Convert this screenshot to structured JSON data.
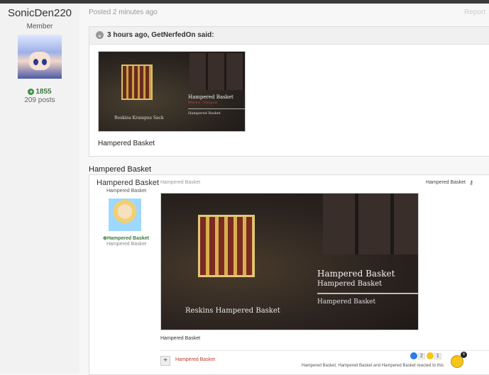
{
  "author": {
    "name": "SonicDen220",
    "role": "Member",
    "reputation": "1855",
    "posts": "209 posts"
  },
  "post": {
    "meta": "Posted 2 minutes ago",
    "report": "Report",
    "quote": {
      "header": "3 hours ago, GetNerfedOn said:",
      "image_text": {
        "item_name": "Hampered Basket",
        "subtitle": "Woven - Elegant",
        "item_name_small": "Hampered Basket",
        "reskins_label": "Reskins Krampus Sack"
      },
      "text": "Hampered Basket"
    },
    "embed_label": "Hampered Basket",
    "embed": {
      "author_name": "Hampered Basket",
      "author_role": "Hampered Basket",
      "reputation": "Hampered Basket",
      "posts": "Hampered Basket",
      "meta": "Hampered Basket",
      "title_right": "Hampered Basket",
      "image_text": {
        "item_name": "Hampered Basket",
        "item_name_2": "Hampered Basket",
        "item_name_3": "Hampered Basket",
        "reskins_label": "Reskins Hampered Basket"
      },
      "caption": "Hampered Basket",
      "link": "Hampered Basket",
      "reactions": [
        {
          "color": "#2b7de9",
          "count": "2"
        },
        {
          "color": "#f5c518",
          "count": "1"
        }
      ],
      "reacted_text": "Hampered Basket, Hampered Basket and Hampered Basket reacted to this"
    }
  },
  "colors": {
    "accent_red": "#c0392b",
    "reputation_green": "#3c7a3c"
  }
}
